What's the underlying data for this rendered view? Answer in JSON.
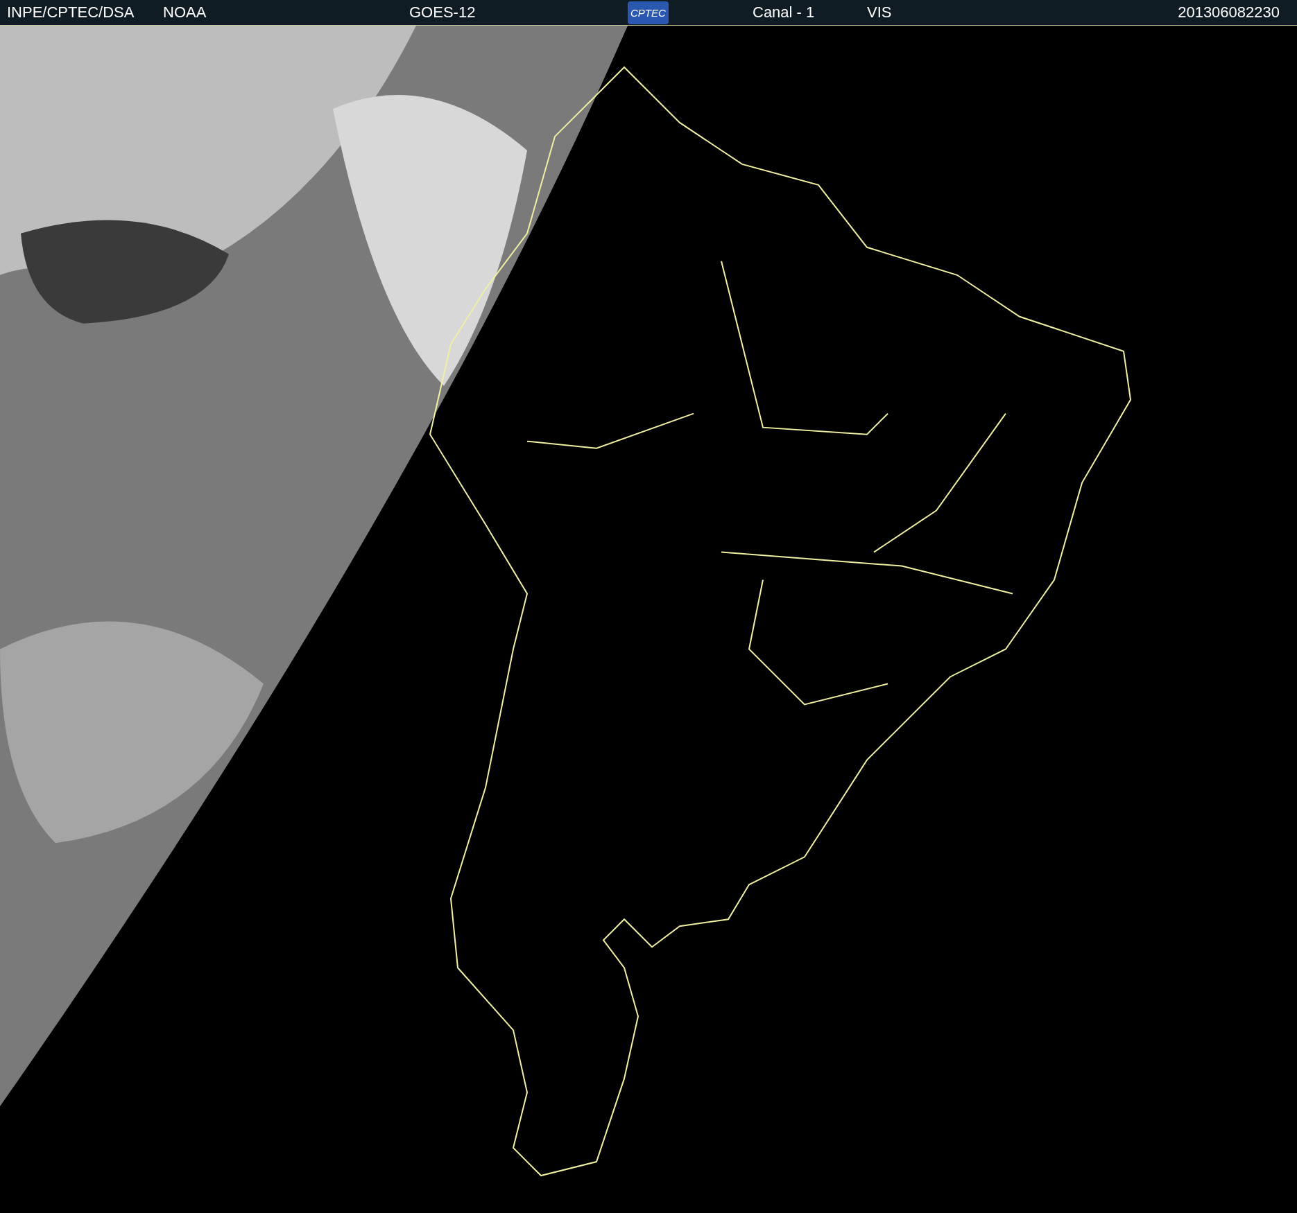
{
  "header": {
    "agency": "INPE/CPTEC/DSA",
    "source": "NOAA",
    "satellite": "GOES-12",
    "logo": "CPTEC",
    "channel": "Canal - 1",
    "band": "VIS",
    "timestamp": "201306082230"
  }
}
